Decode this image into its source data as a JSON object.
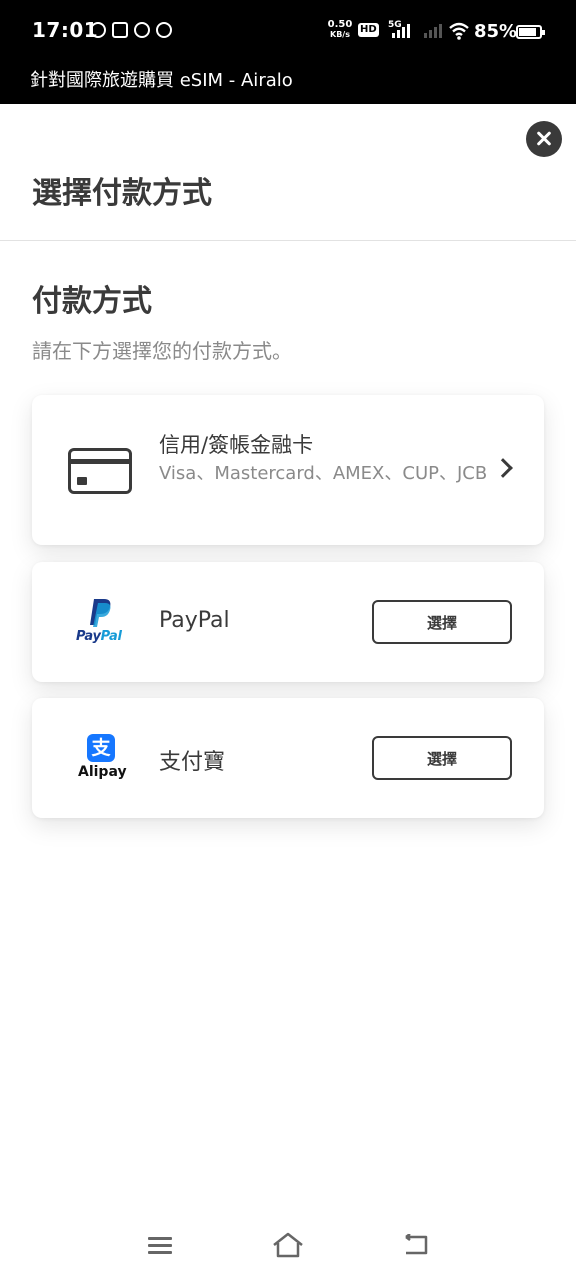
{
  "status_bar": {
    "time": "17:01",
    "net_speed_value": "0.50",
    "net_speed_unit": "KB/s",
    "hd_label": "HD",
    "network_label": "5G",
    "battery_percent": "85%",
    "battery_level": 0.85
  },
  "browser": {
    "page_title": "針對國際旅遊購買 eSIM - Airalo"
  },
  "sheet": {
    "title": "選擇付款方式",
    "section_title": "付款方式",
    "section_subtitle": "請在下方選擇您的付款方式。"
  },
  "methods": {
    "card": {
      "label": "信用/簽帳金融卡",
      "brands": "Visa、Mastercard、AMEX、CUP、JCB"
    },
    "paypal": {
      "label": "PayPal",
      "logo_text_a": "Pay",
      "logo_text_b": "Pal",
      "button_label": "選擇"
    },
    "alipay": {
      "label": "支付寶",
      "logo_glyph": "支",
      "logo_text": "Alipay",
      "button_label": "選擇"
    }
  },
  "colors": {
    "paypal_dark": "#1a3a8a",
    "paypal_light": "#169bd7",
    "alipay_blue": "#1677ff"
  }
}
